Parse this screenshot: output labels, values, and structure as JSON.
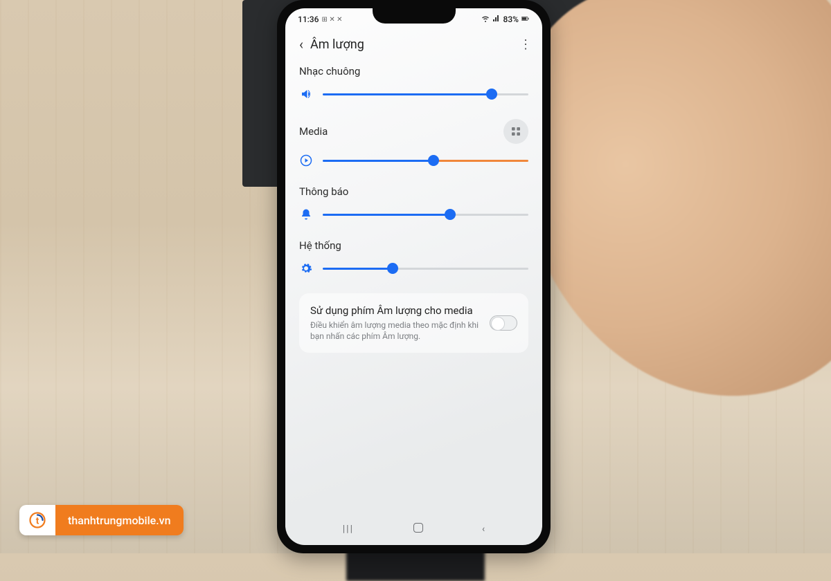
{
  "status": {
    "time": "11:36",
    "battery": "83%"
  },
  "header": {
    "title": "Âm lượng"
  },
  "sliders": {
    "ringtone": {
      "label": "Nhạc chuông",
      "value": 82
    },
    "media": {
      "label": "Media",
      "value": 54
    },
    "notify": {
      "label": "Thông báo",
      "value": 62
    },
    "system": {
      "label": "Hệ thống",
      "value": 34
    }
  },
  "volume_key_card": {
    "title": "Sử dụng phím Âm lượng cho media",
    "subtitle": "Điều khiển âm lượng media theo mặc định khi bạn nhấn các phím Âm lượng.",
    "enabled": false
  },
  "watermark": {
    "text": "thanhtrungmobile.vn"
  }
}
